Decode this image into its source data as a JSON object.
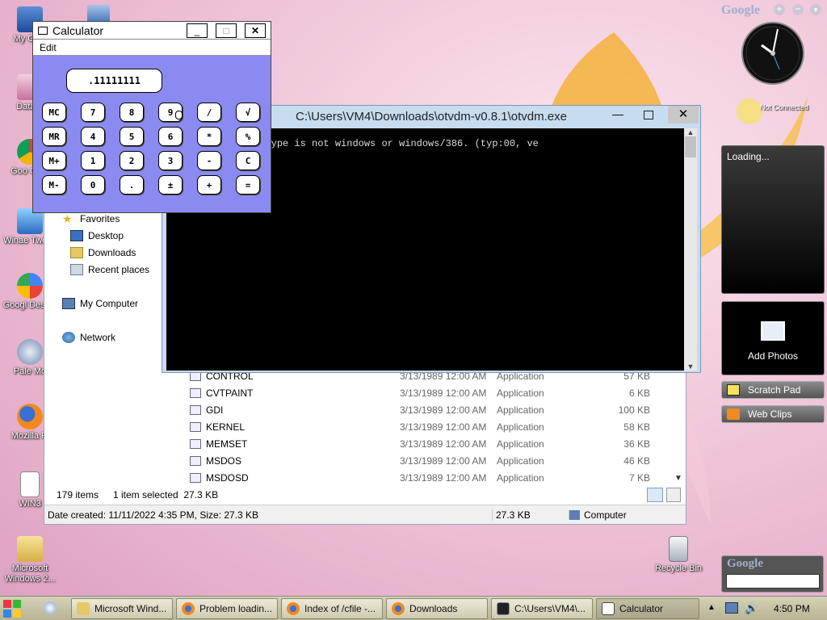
{
  "desktop": {
    "icons": [
      {
        "label": "My Com",
        "icon": "my-computer-icon"
      },
      {
        "label": "DataW",
        "icon": "shortcut-icon"
      },
      {
        "label": "Goo Chro",
        "icon": "chrome-icon"
      },
      {
        "label": "Winae Tweak",
        "icon": "shortcut-icon"
      },
      {
        "label": "Googl Deskto",
        "icon": "google-desktop-icon"
      },
      {
        "label": "Pale Mo",
        "icon": "pale-moon-icon"
      },
      {
        "label": "Mozilla Fi",
        "icon": "firefox-icon"
      },
      {
        "label": "WIN3",
        "icon": "document-icon"
      },
      {
        "label": "Microsoft Windows 2...",
        "icon": "folder-icon"
      },
      {
        "label": "Recycle Bin",
        "icon": "recycle-bin-icon"
      }
    ]
  },
  "calculator": {
    "title": "Calculator",
    "menu": "Edit",
    "display": ".11111111",
    "buttons": [
      [
        "MC",
        "7",
        "8",
        "9",
        "/",
        "√"
      ],
      [
        "MR",
        "4",
        "5",
        "6",
        "*",
        "%"
      ],
      [
        "M+",
        "1",
        "2",
        "3",
        "-",
        "C"
      ],
      [
        "M-",
        "0",
        ".",
        "±",
        "+",
        "="
      ]
    ],
    "title_buttons": [
      "_",
      "□",
      "✕"
    ]
  },
  "console": {
    "title": "C:\\Users\\VM4\\Downloads\\otvdm-v0.8.1\\otvdm.exe",
    "text": "build_module exe type is not windows or windows/386. (typ:00, ve"
  },
  "explorer": {
    "nav": {
      "favorites": "Favorites",
      "desktop": "Desktop",
      "downloads": "Downloads",
      "recent": "Recent places",
      "computer": "My Computer",
      "network": "Network"
    },
    "files": [
      {
        "name": "CONTROL",
        "date": "3/13/1989 12:00 AM",
        "type": "Application",
        "size": "57 KB"
      },
      {
        "name": "CVTPAINT",
        "date": "3/13/1989 12:00 AM",
        "type": "Application",
        "size": "6 KB"
      },
      {
        "name": "GDI",
        "date": "3/13/1989 12:00 AM",
        "type": "Application",
        "size": "100 KB"
      },
      {
        "name": "KERNEL",
        "date": "3/13/1989 12:00 AM",
        "type": "Application",
        "size": "58 KB"
      },
      {
        "name": "MEMSET",
        "date": "3/13/1989 12:00 AM",
        "type": "Application",
        "size": "36 KB"
      },
      {
        "name": "MSDOS",
        "date": "3/13/1989 12:00 AM",
        "type": "Application",
        "size": "46 KB"
      },
      {
        "name": "MSDOSD",
        "date": "3/13/1989 12:00 AM",
        "type": "Application",
        "size": "7 KB"
      }
    ],
    "status_items": "179 items",
    "status_selected": "1 item selected  27.3 KB",
    "details": "Date created: 11/11/2022 4:35 PM, Size: 27.3 KB",
    "details_size": "27.3 KB",
    "details_location": "Computer"
  },
  "sidebar": {
    "google_logo": "Google",
    "not_connected": "Not Connected",
    "loading": "Loading...",
    "add_photos": "Add Photos",
    "scratch_pad": "Scratch Pad",
    "web_clips": "Web Clips",
    "search_logo": "Google"
  },
  "taskbar": {
    "tasks": [
      {
        "label": "Microsoft Wind...",
        "icon": "folder-icon"
      },
      {
        "label": "Problem loadin...",
        "icon": "firefox-icon"
      },
      {
        "label": "Index of /cfile -...",
        "icon": "firefox-icon"
      },
      {
        "label": "Downloads",
        "icon": "firefox-icon"
      },
      {
        "label": "C:\\Users\\VM4\\...",
        "icon": "console-icon"
      },
      {
        "label": "Calculator",
        "icon": "calculator-icon"
      }
    ],
    "clock": "4:50 PM"
  }
}
